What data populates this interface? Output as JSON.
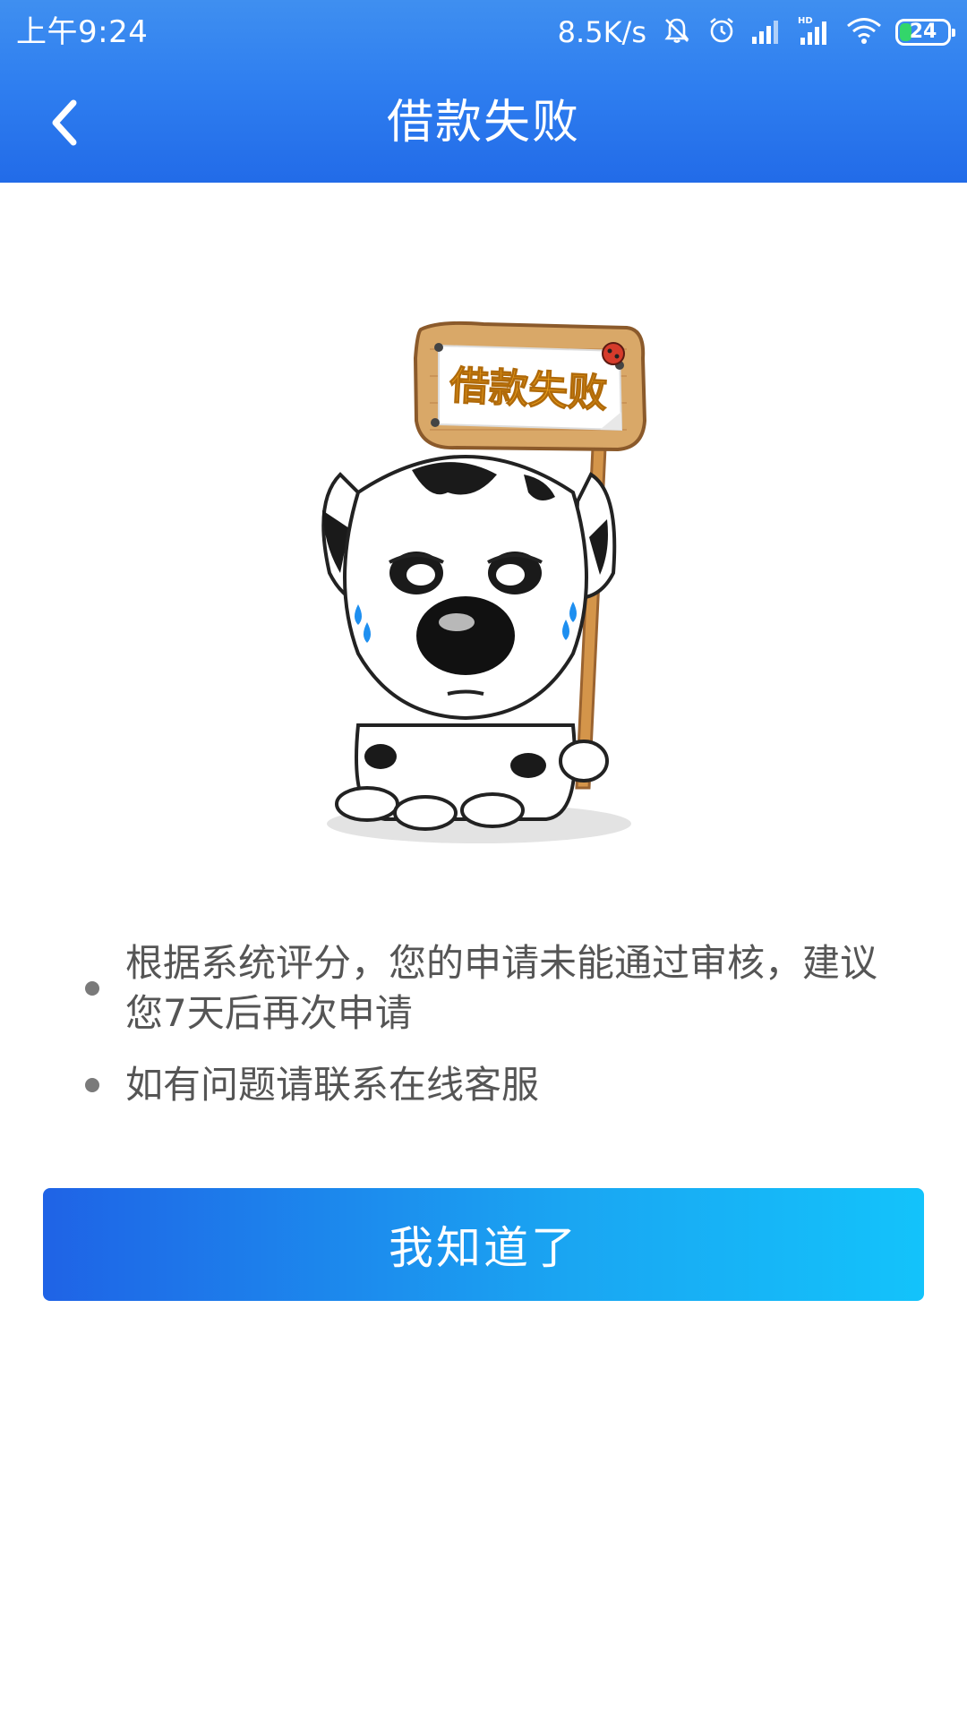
{
  "status_bar": {
    "time": "上午9:24",
    "net_speed": "8.5K/s",
    "battery_level": "24",
    "battery_fraction": 0.24,
    "icons": [
      "bell-muted-icon",
      "alarm-icon",
      "signal-icon",
      "hd-signal-icon",
      "wifi-icon",
      "battery-icon"
    ]
  },
  "header": {
    "title": "借款失败",
    "back_icon": "chevron-left-icon"
  },
  "illustration": {
    "sign_text": "借款失败",
    "description_icon": "crying-dog-illustration"
  },
  "tips": [
    {
      "text": "根据系统评分，您的申请未能通过审核，建议您7天后再次申请"
    },
    {
      "text": "如有问题请联系在线客服"
    }
  ],
  "button": {
    "label": "我知道了"
  },
  "colors": {
    "header_top": "#3f8ff0",
    "header_bottom": "#226be8",
    "button_start": "#1f63e6",
    "button_end": "#13c3fb",
    "tip_text": "#555555"
  }
}
